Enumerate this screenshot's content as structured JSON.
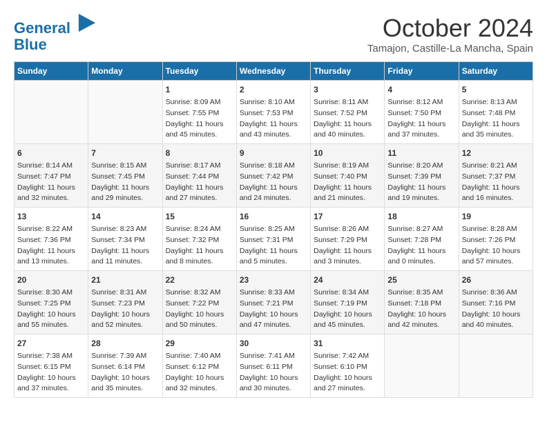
{
  "header": {
    "logo_line1": "General",
    "logo_line2": "Blue",
    "month": "October 2024",
    "location": "Tamajon, Castille-La Mancha, Spain"
  },
  "days_of_week": [
    "Sunday",
    "Monday",
    "Tuesday",
    "Wednesday",
    "Thursday",
    "Friday",
    "Saturday"
  ],
  "weeks": [
    [
      {
        "day": "",
        "content": ""
      },
      {
        "day": "",
        "content": ""
      },
      {
        "day": "1",
        "content": "Sunrise: 8:09 AM\nSunset: 7:55 PM\nDaylight: 11 hours\nand 45 minutes."
      },
      {
        "day": "2",
        "content": "Sunrise: 8:10 AM\nSunset: 7:53 PM\nDaylight: 11 hours\nand 43 minutes."
      },
      {
        "day": "3",
        "content": "Sunrise: 8:11 AM\nSunset: 7:52 PM\nDaylight: 11 hours\nand 40 minutes."
      },
      {
        "day": "4",
        "content": "Sunrise: 8:12 AM\nSunset: 7:50 PM\nDaylight: 11 hours\nand 37 minutes."
      },
      {
        "day": "5",
        "content": "Sunrise: 8:13 AM\nSunset: 7:48 PM\nDaylight: 11 hours\nand 35 minutes."
      }
    ],
    [
      {
        "day": "6",
        "content": "Sunrise: 8:14 AM\nSunset: 7:47 PM\nDaylight: 11 hours\nand 32 minutes."
      },
      {
        "day": "7",
        "content": "Sunrise: 8:15 AM\nSunset: 7:45 PM\nDaylight: 11 hours\nand 29 minutes."
      },
      {
        "day": "8",
        "content": "Sunrise: 8:17 AM\nSunset: 7:44 PM\nDaylight: 11 hours\nand 27 minutes."
      },
      {
        "day": "9",
        "content": "Sunrise: 8:18 AM\nSunset: 7:42 PM\nDaylight: 11 hours\nand 24 minutes."
      },
      {
        "day": "10",
        "content": "Sunrise: 8:19 AM\nSunset: 7:40 PM\nDaylight: 11 hours\nand 21 minutes."
      },
      {
        "day": "11",
        "content": "Sunrise: 8:20 AM\nSunset: 7:39 PM\nDaylight: 11 hours\nand 19 minutes."
      },
      {
        "day": "12",
        "content": "Sunrise: 8:21 AM\nSunset: 7:37 PM\nDaylight: 11 hours\nand 16 minutes."
      }
    ],
    [
      {
        "day": "13",
        "content": "Sunrise: 8:22 AM\nSunset: 7:36 PM\nDaylight: 11 hours\nand 13 minutes."
      },
      {
        "day": "14",
        "content": "Sunrise: 8:23 AM\nSunset: 7:34 PM\nDaylight: 11 hours\nand 11 minutes."
      },
      {
        "day": "15",
        "content": "Sunrise: 8:24 AM\nSunset: 7:32 PM\nDaylight: 11 hours\nand 8 minutes."
      },
      {
        "day": "16",
        "content": "Sunrise: 8:25 AM\nSunset: 7:31 PM\nDaylight: 11 hours\nand 5 minutes."
      },
      {
        "day": "17",
        "content": "Sunrise: 8:26 AM\nSunset: 7:29 PM\nDaylight: 11 hours\nand 3 minutes."
      },
      {
        "day": "18",
        "content": "Sunrise: 8:27 AM\nSunset: 7:28 PM\nDaylight: 11 hours\nand 0 minutes."
      },
      {
        "day": "19",
        "content": "Sunrise: 8:28 AM\nSunset: 7:26 PM\nDaylight: 10 hours\nand 57 minutes."
      }
    ],
    [
      {
        "day": "20",
        "content": "Sunrise: 8:30 AM\nSunset: 7:25 PM\nDaylight: 10 hours\nand 55 minutes."
      },
      {
        "day": "21",
        "content": "Sunrise: 8:31 AM\nSunset: 7:23 PM\nDaylight: 10 hours\nand 52 minutes."
      },
      {
        "day": "22",
        "content": "Sunrise: 8:32 AM\nSunset: 7:22 PM\nDaylight: 10 hours\nand 50 minutes."
      },
      {
        "day": "23",
        "content": "Sunrise: 8:33 AM\nSunset: 7:21 PM\nDaylight: 10 hours\nand 47 minutes."
      },
      {
        "day": "24",
        "content": "Sunrise: 8:34 AM\nSunset: 7:19 PM\nDaylight: 10 hours\nand 45 minutes."
      },
      {
        "day": "25",
        "content": "Sunrise: 8:35 AM\nSunset: 7:18 PM\nDaylight: 10 hours\nand 42 minutes."
      },
      {
        "day": "26",
        "content": "Sunrise: 8:36 AM\nSunset: 7:16 PM\nDaylight: 10 hours\nand 40 minutes."
      }
    ],
    [
      {
        "day": "27",
        "content": "Sunrise: 7:38 AM\nSunset: 6:15 PM\nDaylight: 10 hours\nand 37 minutes."
      },
      {
        "day": "28",
        "content": "Sunrise: 7:39 AM\nSunset: 6:14 PM\nDaylight: 10 hours\nand 35 minutes."
      },
      {
        "day": "29",
        "content": "Sunrise: 7:40 AM\nSunset: 6:12 PM\nDaylight: 10 hours\nand 32 minutes."
      },
      {
        "day": "30",
        "content": "Sunrise: 7:41 AM\nSunset: 6:11 PM\nDaylight: 10 hours\nand 30 minutes."
      },
      {
        "day": "31",
        "content": "Sunrise: 7:42 AM\nSunset: 6:10 PM\nDaylight: 10 hours\nand 27 minutes."
      },
      {
        "day": "",
        "content": ""
      },
      {
        "day": "",
        "content": ""
      }
    ]
  ]
}
